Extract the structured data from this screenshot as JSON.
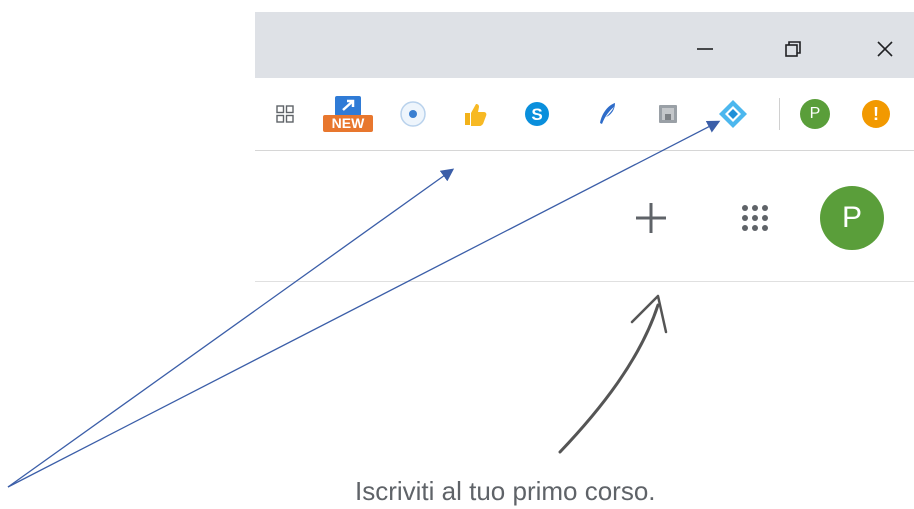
{
  "window": {
    "minimize_icon": "minimize-icon",
    "restore_icon": "restore-icon",
    "close_icon": "close-icon"
  },
  "toolbar": {
    "new_badge": "NEW",
    "profile_initial": "P",
    "alert_glyph": "!",
    "icons": [
      "apps-grid-icon",
      "new-extension-icon",
      "radio-extension-icon",
      "thumbs-up-icon",
      "skype-icon",
      "feather-icon",
      "gray-extension-icon",
      "diamond-extension-icon"
    ]
  },
  "app_bar": {
    "add_icon": "plus-icon",
    "apps_icon": "apps-dots-icon",
    "avatar_initial": "P"
  },
  "main": {
    "hint_text": "Iscriviti al tuo primo corso."
  },
  "colors": {
    "titlebar": "#dee1e6",
    "avatar": "#5a9e3a",
    "warning": "#f29900",
    "annotation_arrow": "#3b5ea8"
  }
}
